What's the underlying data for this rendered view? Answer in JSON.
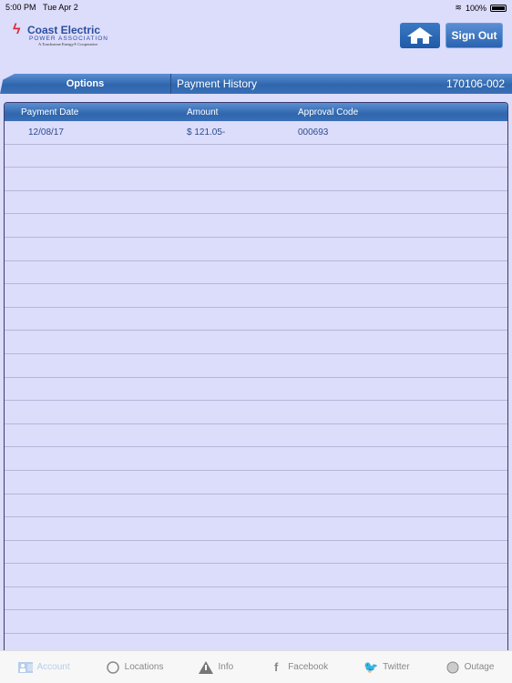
{
  "status_bar": {
    "time": "5:00 PM",
    "date": "Tue Apr 2",
    "battery": "100%"
  },
  "logo": {
    "name": "Coast Electric",
    "subtitle": "POWER ASSOCIATION",
    "tagline": "A Touchstone Energy® Cooperative"
  },
  "header": {
    "home_icon": "home-icon",
    "sign_out_label": "Sign Out"
  },
  "navbar": {
    "options_label": "Options",
    "title": "Payment History",
    "account_number": "170106-002"
  },
  "table": {
    "columns": [
      "Payment Date",
      "Amount",
      "Approval Code"
    ],
    "rows": [
      {
        "date": "12/08/17",
        "amount": "$ 121.05-",
        "approval": "000693"
      }
    ]
  },
  "tabbar": {
    "items": [
      {
        "label": "Account",
        "icon": "account-card-icon",
        "active": true
      },
      {
        "label": "Locations",
        "icon": "locations-icon"
      },
      {
        "label": "Info",
        "icon": "warning-icon"
      },
      {
        "label": "Facebook",
        "icon": "facebook-icon"
      },
      {
        "label": "Twitter",
        "icon": "twitter-icon"
      },
      {
        "label": "Outage",
        "icon": "globe-icon"
      }
    ]
  }
}
